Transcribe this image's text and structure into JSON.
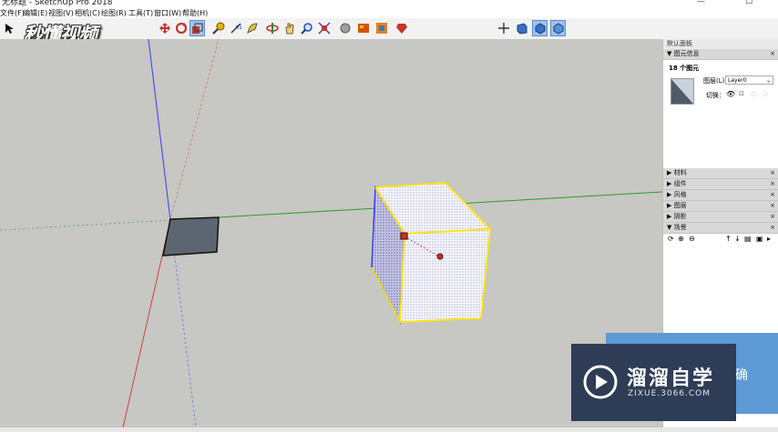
{
  "window": {
    "title": "无标题 - SketchUp Pro 2018",
    "minimize": "—",
    "maximize": "☐"
  },
  "menu": [
    "文件(F)",
    "编辑(E)",
    "视图(V)",
    "相机(C)",
    "绘图(R)",
    "工具(T)",
    "窗口(W)",
    "帮助(H)"
  ],
  "logo_text": "秒懂视频",
  "tray": {
    "title": "默认面板",
    "entity_info": {
      "header": "▼ 图元信息",
      "count": "18 个图元",
      "layer_label": "图层(L):",
      "layer_value": "Layer0",
      "toggle_label": "切换："
    },
    "panels": [
      "▶ 材料",
      "▶ 组件",
      "▶ 风格",
      "▶ 图层",
      "▶ 阴影"
    ],
    "scenes_header": "▼ 场景",
    "close": "×"
  },
  "watermark": {
    "brand": "溜溜自学",
    "url": "ZIXUE.3066.COM",
    "partial": "确"
  },
  "colors": {
    "viewport_bg": "#c7c7c3",
    "selection": "#ffe600",
    "axis_blue": "#3a3aff",
    "axis_green": "#2c9a2c",
    "axis_red": "#d04040"
  }
}
